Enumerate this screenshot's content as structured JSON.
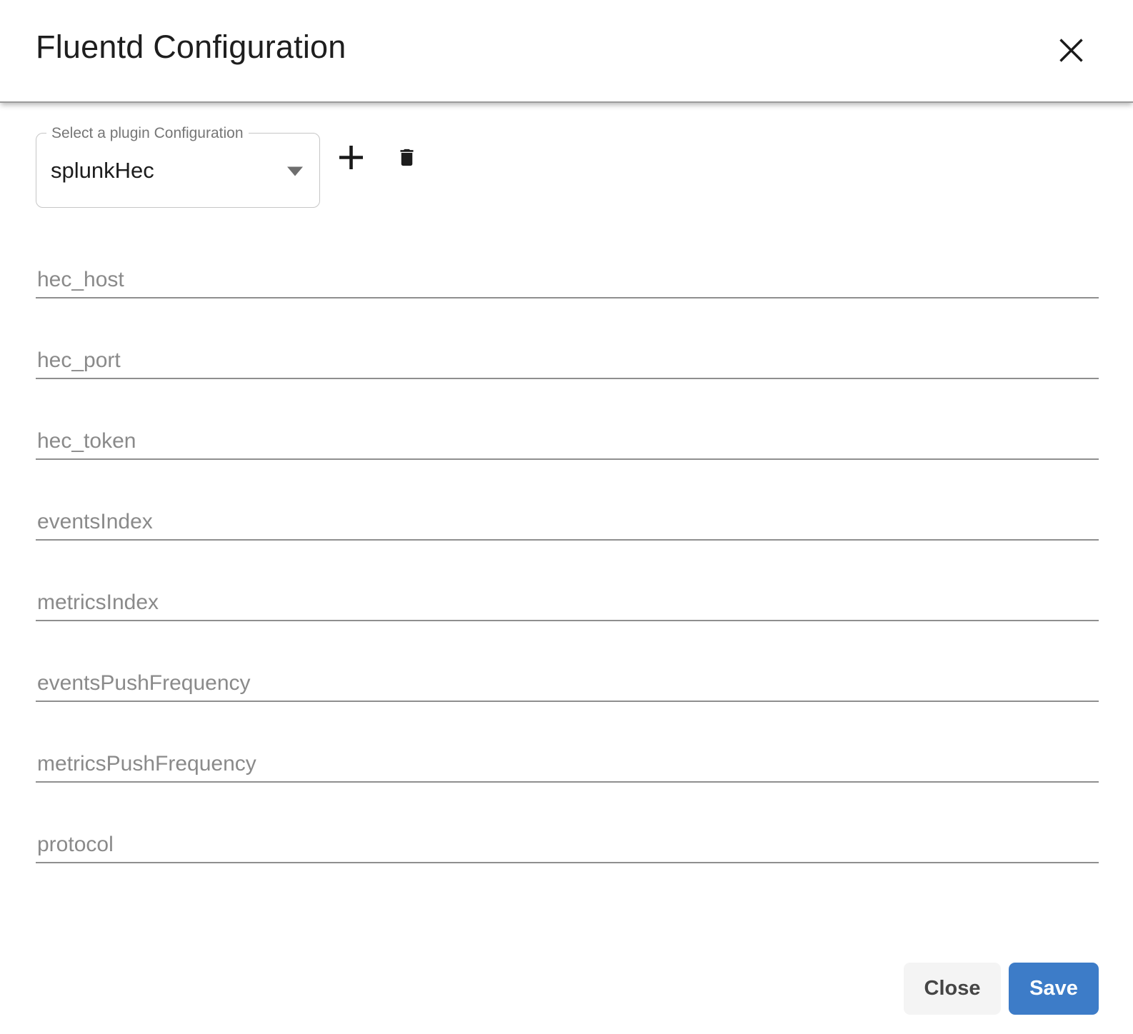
{
  "dialog": {
    "title": "Fluentd Configuration"
  },
  "plugin_selector": {
    "label": "Select a plugin Configuration",
    "value": "splunkHec"
  },
  "fields": [
    {
      "label": "hec_host",
      "value": ""
    },
    {
      "label": "hec_port",
      "value": ""
    },
    {
      "label": "hec_token",
      "value": ""
    },
    {
      "label": "eventsIndex",
      "value": ""
    },
    {
      "label": "metricsIndex",
      "value": ""
    },
    {
      "label": "eventsPushFrequency",
      "value": ""
    },
    {
      "label": "metricsPushFrequency",
      "value": ""
    },
    {
      "label": "protocol",
      "value": ""
    }
  ],
  "footer": {
    "close_label": "Close",
    "save_label": "Save"
  },
  "icons": {
    "header_close": "x-icon",
    "add": "plus-icon",
    "delete": "trash-icon",
    "dropdown": "chevron-down-icon"
  },
  "colors": {
    "save_button_bg": "#3d7cc8",
    "save_button_text": "#ffffff",
    "close_button_bg": "#f4f4f4",
    "divider": "#9b9b9b",
    "field_underline": "#8f8f8f",
    "label_gray": "#8a8a8a"
  }
}
